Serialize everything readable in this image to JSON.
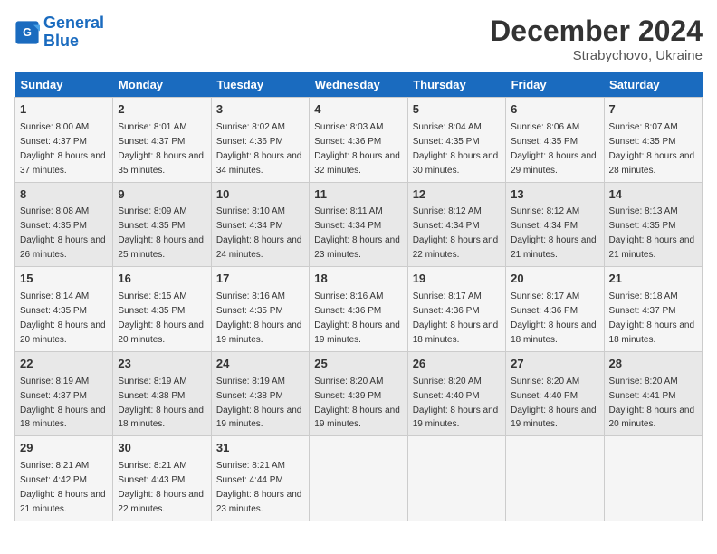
{
  "header": {
    "logo_line1": "General",
    "logo_line2": "Blue",
    "month": "December 2024",
    "location": "Strabychovo, Ukraine"
  },
  "days_of_week": [
    "Sunday",
    "Monday",
    "Tuesday",
    "Wednesday",
    "Thursday",
    "Friday",
    "Saturday"
  ],
  "weeks": [
    [
      {
        "day": "1",
        "sunrise": "8:00 AM",
        "sunset": "4:37 PM",
        "daylight": "8 hours and 37 minutes."
      },
      {
        "day": "2",
        "sunrise": "8:01 AM",
        "sunset": "4:37 PM",
        "daylight": "8 hours and 35 minutes."
      },
      {
        "day": "3",
        "sunrise": "8:02 AM",
        "sunset": "4:36 PM",
        "daylight": "8 hours and 34 minutes."
      },
      {
        "day": "4",
        "sunrise": "8:03 AM",
        "sunset": "4:36 PM",
        "daylight": "8 hours and 32 minutes."
      },
      {
        "day": "5",
        "sunrise": "8:04 AM",
        "sunset": "4:35 PM",
        "daylight": "8 hours and 30 minutes."
      },
      {
        "day": "6",
        "sunrise": "8:06 AM",
        "sunset": "4:35 PM",
        "daylight": "8 hours and 29 minutes."
      },
      {
        "day": "7",
        "sunrise": "8:07 AM",
        "sunset": "4:35 PM",
        "daylight": "8 hours and 28 minutes."
      }
    ],
    [
      {
        "day": "8",
        "sunrise": "8:08 AM",
        "sunset": "4:35 PM",
        "daylight": "8 hours and 26 minutes."
      },
      {
        "day": "9",
        "sunrise": "8:09 AM",
        "sunset": "4:35 PM",
        "daylight": "8 hours and 25 minutes."
      },
      {
        "day": "10",
        "sunrise": "8:10 AM",
        "sunset": "4:34 PM",
        "daylight": "8 hours and 24 minutes."
      },
      {
        "day": "11",
        "sunrise": "8:11 AM",
        "sunset": "4:34 PM",
        "daylight": "8 hours and 23 minutes."
      },
      {
        "day": "12",
        "sunrise": "8:12 AM",
        "sunset": "4:34 PM",
        "daylight": "8 hours and 22 minutes."
      },
      {
        "day": "13",
        "sunrise": "8:12 AM",
        "sunset": "4:34 PM",
        "daylight": "8 hours and 21 minutes."
      },
      {
        "day": "14",
        "sunrise": "8:13 AM",
        "sunset": "4:35 PM",
        "daylight": "8 hours and 21 minutes."
      }
    ],
    [
      {
        "day": "15",
        "sunrise": "8:14 AM",
        "sunset": "4:35 PM",
        "daylight": "8 hours and 20 minutes."
      },
      {
        "day": "16",
        "sunrise": "8:15 AM",
        "sunset": "4:35 PM",
        "daylight": "8 hours and 20 minutes."
      },
      {
        "day": "17",
        "sunrise": "8:16 AM",
        "sunset": "4:35 PM",
        "daylight": "8 hours and 19 minutes."
      },
      {
        "day": "18",
        "sunrise": "8:16 AM",
        "sunset": "4:36 PM",
        "daylight": "8 hours and 19 minutes."
      },
      {
        "day": "19",
        "sunrise": "8:17 AM",
        "sunset": "4:36 PM",
        "daylight": "8 hours and 18 minutes."
      },
      {
        "day": "20",
        "sunrise": "8:17 AM",
        "sunset": "4:36 PM",
        "daylight": "8 hours and 18 minutes."
      },
      {
        "day": "21",
        "sunrise": "8:18 AM",
        "sunset": "4:37 PM",
        "daylight": "8 hours and 18 minutes."
      }
    ],
    [
      {
        "day": "22",
        "sunrise": "8:19 AM",
        "sunset": "4:37 PM",
        "daylight": "8 hours and 18 minutes."
      },
      {
        "day": "23",
        "sunrise": "8:19 AM",
        "sunset": "4:38 PM",
        "daylight": "8 hours and 18 minutes."
      },
      {
        "day": "24",
        "sunrise": "8:19 AM",
        "sunset": "4:38 PM",
        "daylight": "8 hours and 19 minutes."
      },
      {
        "day": "25",
        "sunrise": "8:20 AM",
        "sunset": "4:39 PM",
        "daylight": "8 hours and 19 minutes."
      },
      {
        "day": "26",
        "sunrise": "8:20 AM",
        "sunset": "4:40 PM",
        "daylight": "8 hours and 19 minutes."
      },
      {
        "day": "27",
        "sunrise": "8:20 AM",
        "sunset": "4:40 PM",
        "daylight": "8 hours and 19 minutes."
      },
      {
        "day": "28",
        "sunrise": "8:20 AM",
        "sunset": "4:41 PM",
        "daylight": "8 hours and 20 minutes."
      }
    ],
    [
      {
        "day": "29",
        "sunrise": "8:21 AM",
        "sunset": "4:42 PM",
        "daylight": "8 hours and 21 minutes."
      },
      {
        "day": "30",
        "sunrise": "8:21 AM",
        "sunset": "4:43 PM",
        "daylight": "8 hours and 22 minutes."
      },
      {
        "day": "31",
        "sunrise": "8:21 AM",
        "sunset": "4:44 PM",
        "daylight": "8 hours and 23 minutes."
      },
      null,
      null,
      null,
      null
    ]
  ]
}
